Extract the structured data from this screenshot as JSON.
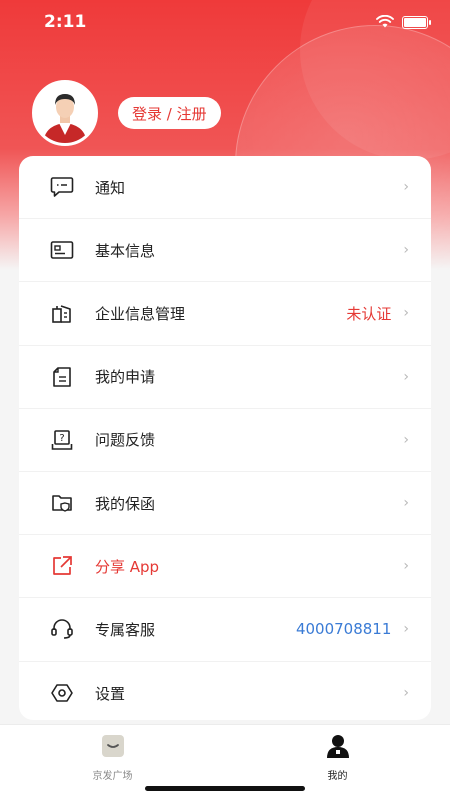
{
  "status": {
    "time": "2:11"
  },
  "profile": {
    "login_label": "登录 / 注册"
  },
  "menu": [
    {
      "label": "通知",
      "value": "",
      "icon": "message-icon"
    },
    {
      "label": "基本信息",
      "value": "",
      "icon": "id-card-icon"
    },
    {
      "label": "企业信息管理",
      "value": "未认证",
      "icon": "building-icon"
    },
    {
      "label": "我的申请",
      "value": "",
      "icon": "document-icon"
    },
    {
      "label": "问题反馈",
      "value": "",
      "icon": "feedback-icon"
    },
    {
      "label": "我的保函",
      "value": "",
      "icon": "folder-shield-icon"
    },
    {
      "label": "分享 App",
      "value": "",
      "icon": "share-icon"
    },
    {
      "label": "专属客服",
      "value": "4000708811",
      "icon": "headset-icon"
    },
    {
      "label": "设置",
      "value": "",
      "icon": "settings-icon"
    }
  ],
  "tabs": [
    {
      "label": "京发广场",
      "active": false
    },
    {
      "label": "我的",
      "active": true
    }
  ],
  "colors": {
    "brand_red": "#e53935",
    "phone_blue": "#3a7bd5"
  }
}
